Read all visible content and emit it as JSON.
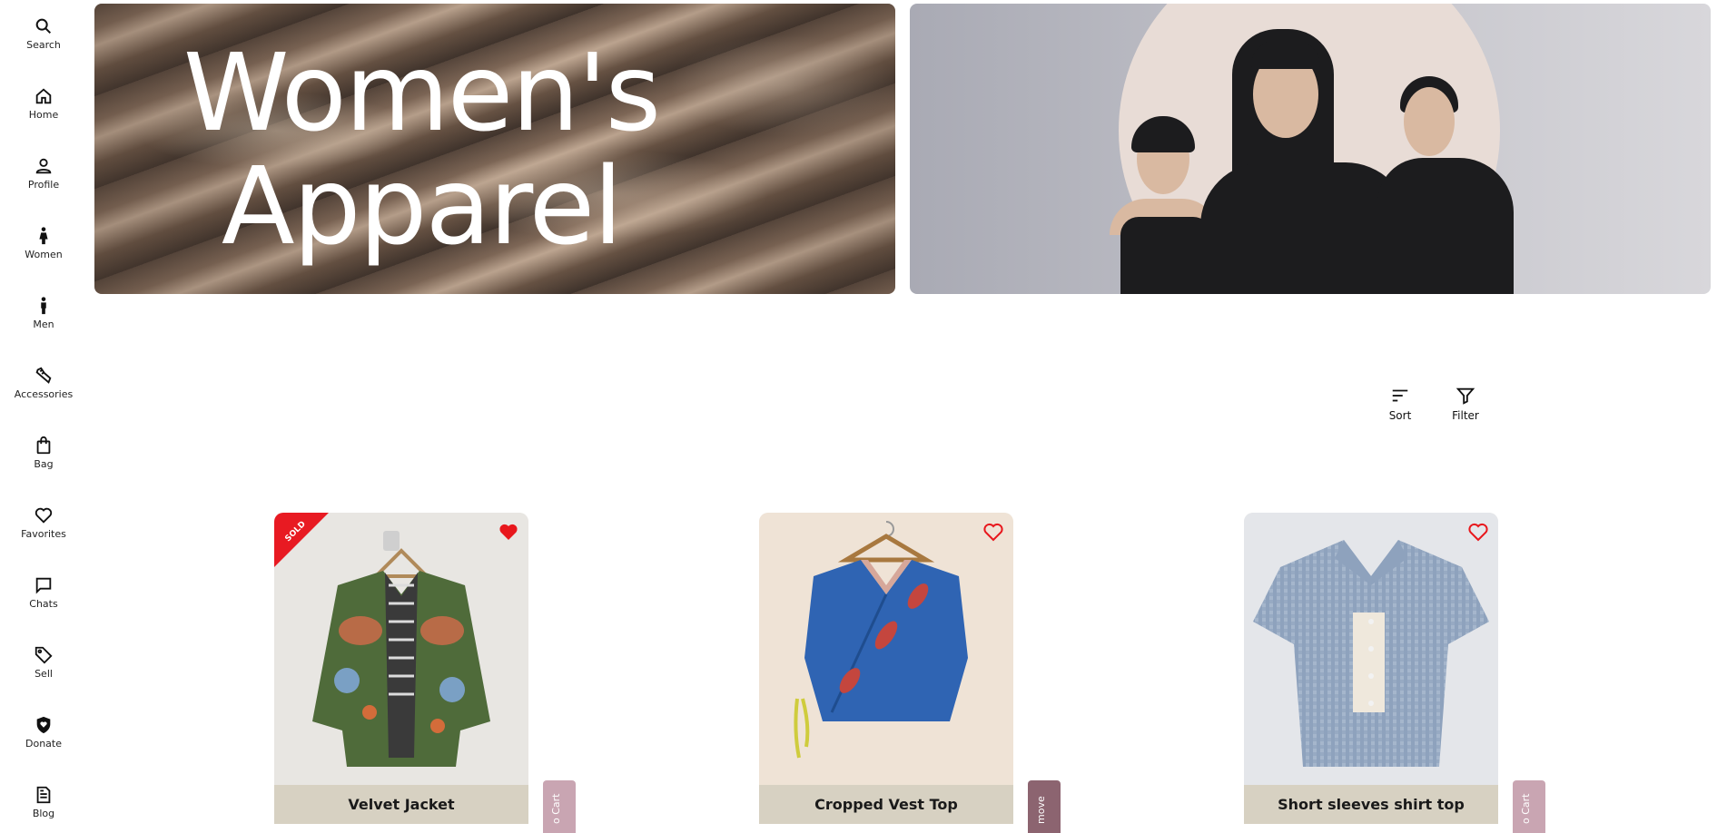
{
  "sidebar": {
    "items": [
      {
        "label": "Search",
        "icon": "search-icon"
      },
      {
        "label": "Home",
        "icon": "home-icon"
      },
      {
        "label": "Profile",
        "icon": "person-icon"
      },
      {
        "label": "Women",
        "icon": "woman-icon"
      },
      {
        "label": "Men",
        "icon": "man-icon"
      },
      {
        "label": "Accessories",
        "icon": "shoe-icon"
      },
      {
        "label": "Bag",
        "icon": "bag-icon"
      },
      {
        "label": "Favorites",
        "icon": "heart-icon"
      },
      {
        "label": "Chats",
        "icon": "chat-icon"
      },
      {
        "label": "Sell",
        "icon": "tag-icon"
      },
      {
        "label": "Donate",
        "icon": "shield-heart-icon"
      },
      {
        "label": "Blog",
        "icon": "document-icon"
      }
    ]
  },
  "hero": {
    "title_line1": "Women's",
    "title_line2": "Apparel"
  },
  "toolbar": {
    "sort_label": "Sort",
    "filter_label": "Filter"
  },
  "products": [
    {
      "title": "Velvet Jacket",
      "sold": true,
      "sold_label": "SOLD",
      "favorited": true,
      "tab_label": "o Cart",
      "tab_color": "#c9a5b2"
    },
    {
      "title": "Cropped Vest Top",
      "sold": false,
      "favorited": false,
      "tab_label": "move",
      "tab_color": "#8c6470"
    },
    {
      "title": "Short sleeves shirt top",
      "sold": false,
      "favorited": false,
      "tab_label": "o Cart",
      "tab_color": "#c9a5b2"
    }
  ],
  "colors": {
    "heart_red": "#e8171c",
    "title_bar": "#d7d1c2",
    "sold_red": "#e81a22"
  }
}
